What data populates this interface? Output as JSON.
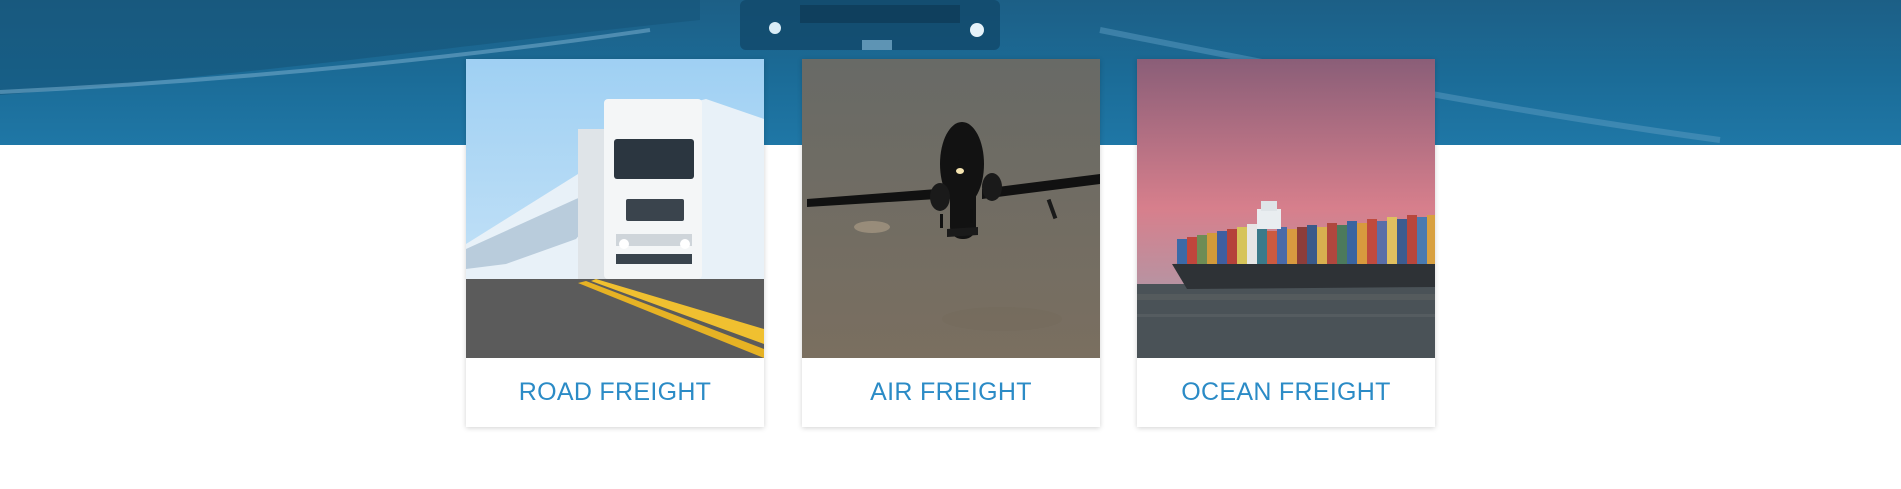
{
  "services": [
    {
      "label": "ROAD FREIGHT",
      "image": "truck-on-road-photo"
    },
    {
      "label": "AIR FREIGHT",
      "image": "airplane-landing-photo"
    },
    {
      "label": "OCEAN FREIGHT",
      "image": "container-ship-photo"
    }
  ],
  "colors": {
    "hero_band": "#1b6c98",
    "label_text": "#2b8bc6",
    "page_background": "#ffffff"
  }
}
